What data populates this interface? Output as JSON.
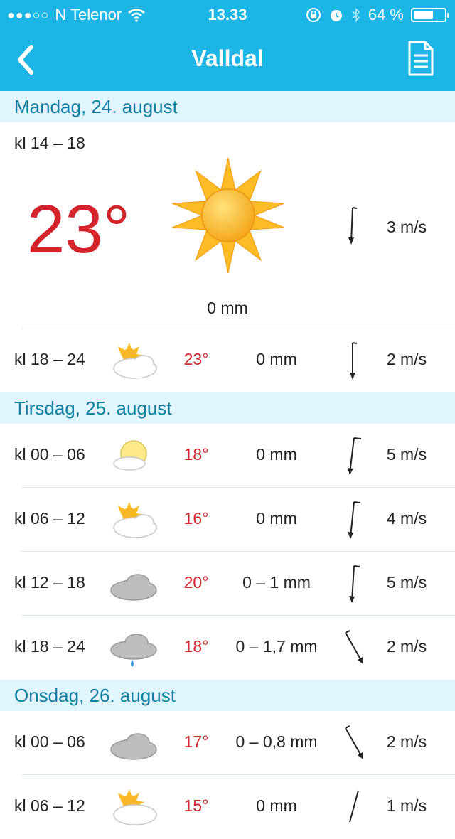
{
  "status_bar": {
    "signal": "●●●○○",
    "carrier": "N Telenor",
    "time": "13.33",
    "battery_text": "64 %",
    "battery_level": 0.64
  },
  "nav": {
    "title": "Valldal"
  },
  "days": [
    {
      "label": "Mandag, 24. august"
    },
    {
      "label": "Tirsdag, 25. august"
    },
    {
      "label": "Onsdag, 26. august"
    }
  ],
  "current": {
    "time": "kl 14 – 18",
    "temp": "23°",
    "precip": "0 mm",
    "wind": "3 m/s",
    "icon": "sun-icon"
  },
  "rows": [
    {
      "time": "kl 18 – 24",
      "temp": "23°",
      "precip": "0 mm",
      "wind": "2 m/s",
      "icon": "partly-cloudy-icon"
    },
    {
      "time": "kl 00 – 06",
      "temp": "18°",
      "precip": "0 mm",
      "wind": "5 m/s",
      "icon": "fair-night-icon"
    },
    {
      "time": "kl 06 – 12",
      "temp": "16°",
      "precip": "0 mm",
      "wind": "4 m/s",
      "icon": "partly-cloudy-icon"
    },
    {
      "time": "kl 12 – 18",
      "temp": "20°",
      "precip": "0 – 1 mm",
      "wind": "5 m/s",
      "icon": "cloud-icon"
    },
    {
      "time": "kl 18 – 24",
      "temp": "18°",
      "precip": "0 – 1,7 mm",
      "wind": "2 m/s",
      "icon": "light-rain-icon"
    },
    {
      "time": "kl 00 – 06",
      "temp": "17°",
      "precip": "0 – 0,8 mm",
      "wind": "2 m/s",
      "icon": "cloud-icon"
    },
    {
      "time": "kl 06 – 12",
      "temp": "15°",
      "precip": "0 mm",
      "wind": "1 m/s",
      "icon": "partly-cloudy-icon"
    }
  ],
  "colors": {
    "accent": "#1bb5e6",
    "temp": "#d3242b",
    "day_header_bg": "#e0f5fd",
    "day_header_text": "#127ea1"
  }
}
